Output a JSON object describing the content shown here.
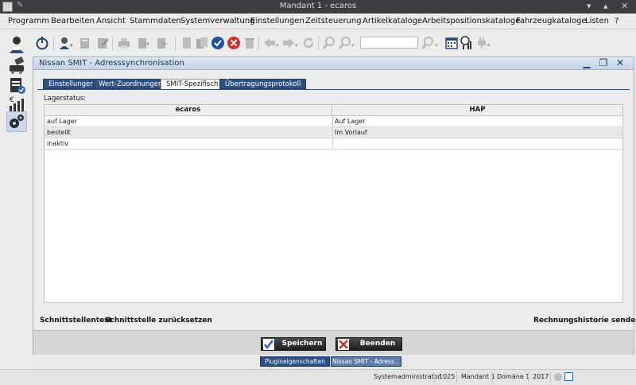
{
  "window": {
    "title": "Mandant 1 - ecaros"
  },
  "menu": [
    "Programm",
    "Bearbeiten",
    "Ansicht",
    "Stammdaten",
    "Systemverwaltung",
    "Einstellungen",
    "Zeitsteuerung",
    "Artikelkataloge",
    "Arbeitspositionskataloge",
    "Fahrzeugkataloge",
    "Listen",
    "?"
  ],
  "sidebar": {
    "items": [
      {
        "icon": "user-support-icon"
      },
      {
        "icon": "vehicle-key-icon"
      },
      {
        "icon": "clipboard-check-icon"
      },
      {
        "icon": "finance-chart-icon"
      },
      {
        "icon": "settings-gears-icon"
      }
    ]
  },
  "toolbar": {
    "icons": [
      "power-icon",
      "user-search-icon",
      "document-copy-icon",
      "document-edit-icon",
      "print-icon",
      "export-icon",
      "import-icon",
      "page-icon",
      "pages-icon",
      "confirm-check-icon",
      "cancel-icon",
      "delete-trash-icon",
      "back-arrow-icon",
      "forward-arrow-icon",
      "refresh-icon",
      "search-icon",
      "search-next-icon",
      "user-find-icon",
      "calendar-icon",
      "clock-chart-icon",
      "plugin-icon"
    ],
    "search_value": ""
  },
  "frame": {
    "title": "Nissan SMIT - Adresssynchronisation",
    "tabs": [
      "Einstellungen",
      "Wert-Zuordnungen",
      "SMIT-Spezifisch",
      "Übertragungsprotokoll"
    ],
    "active_tab": "SMIT-Spezifisch",
    "section_label": "Lagerstatus:",
    "table": {
      "headers": [
        "ecaros",
        "HAP"
      ],
      "rows": [
        [
          "auf Lager",
          "Auf Lager"
        ],
        [
          "bestellt",
          "Im Vorlauf"
        ],
        [
          "inaktiv",
          ""
        ]
      ]
    },
    "links": {
      "test": "Schnittstellentest",
      "reset": "Schnittstelle zurücksetzen",
      "history": "Rechnungshistorie senden"
    },
    "buttons": {
      "save": "Speichern",
      "close": "Beenden"
    }
  },
  "taskbar": [
    "Plugineigenschaften",
    "Nissan SMIT - Adress..."
  ],
  "status": {
    "user": "Systemadministrator",
    "number": "1025",
    "mandant": "Mandant 1",
    "domain": "Domäne 1",
    "year": "2017"
  },
  "colors": {
    "accent": "#2e4f80",
    "frame_title": "#c5d3e6",
    "cancel_red": "#d0302a",
    "confirm_blue": "#2a67b8"
  }
}
